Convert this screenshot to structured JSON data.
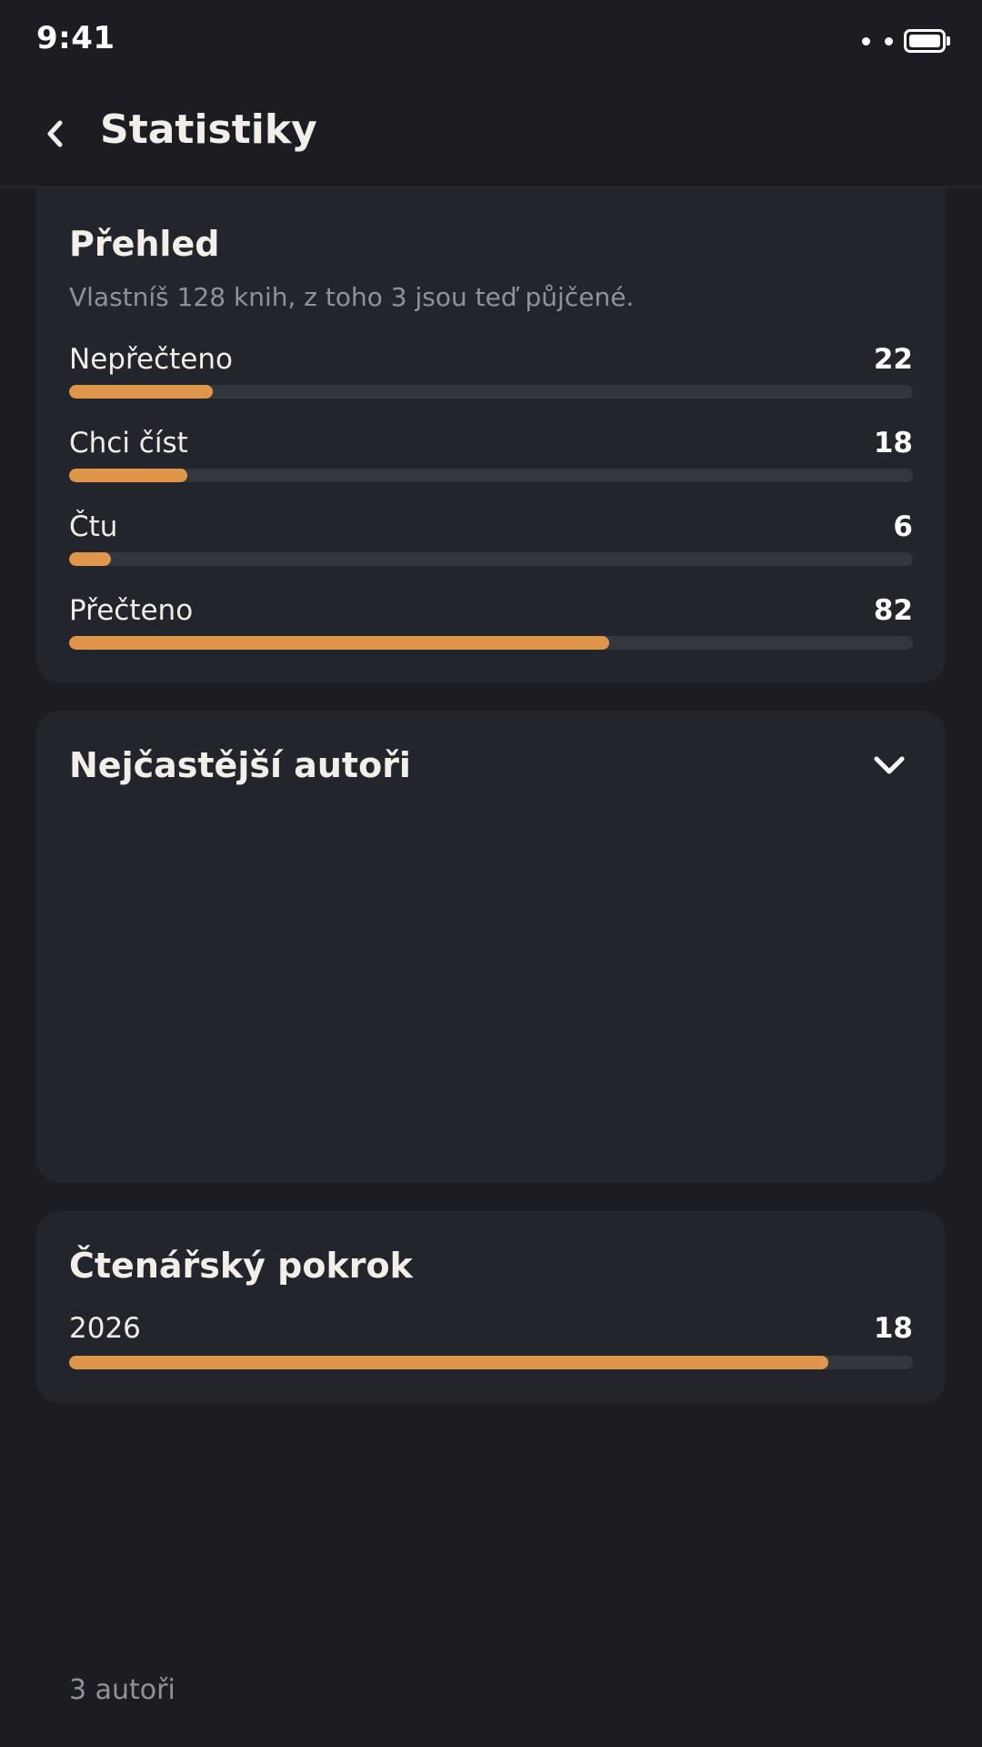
{
  "status_bar": {
    "time": "9:41"
  },
  "header": {
    "title": "Statistiky",
    "back_icon": "chevron-left-icon"
  },
  "overview": {
    "title": "Přehled",
    "summary": "Vlastníš 128 knih, z toho 3 jsou teď půjčené.",
    "total": 128,
    "stats": [
      {
        "label": "Nepřečteno",
        "value": "22",
        "fraction": 0.17
      },
      {
        "label": "Chci číst",
        "value": "18",
        "fraction": 0.14
      },
      {
        "label": "Čtu",
        "value": "6",
        "fraction": 0.05
      },
      {
        "label": "Přečteno",
        "value": "82",
        "fraction": 0.64
      }
    ]
  },
  "authors": {
    "title": "Nejčastější autoři",
    "toggle_icon": "chevron-down-icon",
    "count_label": "3 autoři"
  },
  "progress": {
    "title": "Čtenářský pokrok",
    "year": "2026",
    "value": "18",
    "fraction": 0.9
  },
  "colors": {
    "background": "#1b1d23",
    "card": "#23252d",
    "accent": "#e0964a",
    "track": "#33363f",
    "muted_text": "#8e929b"
  }
}
